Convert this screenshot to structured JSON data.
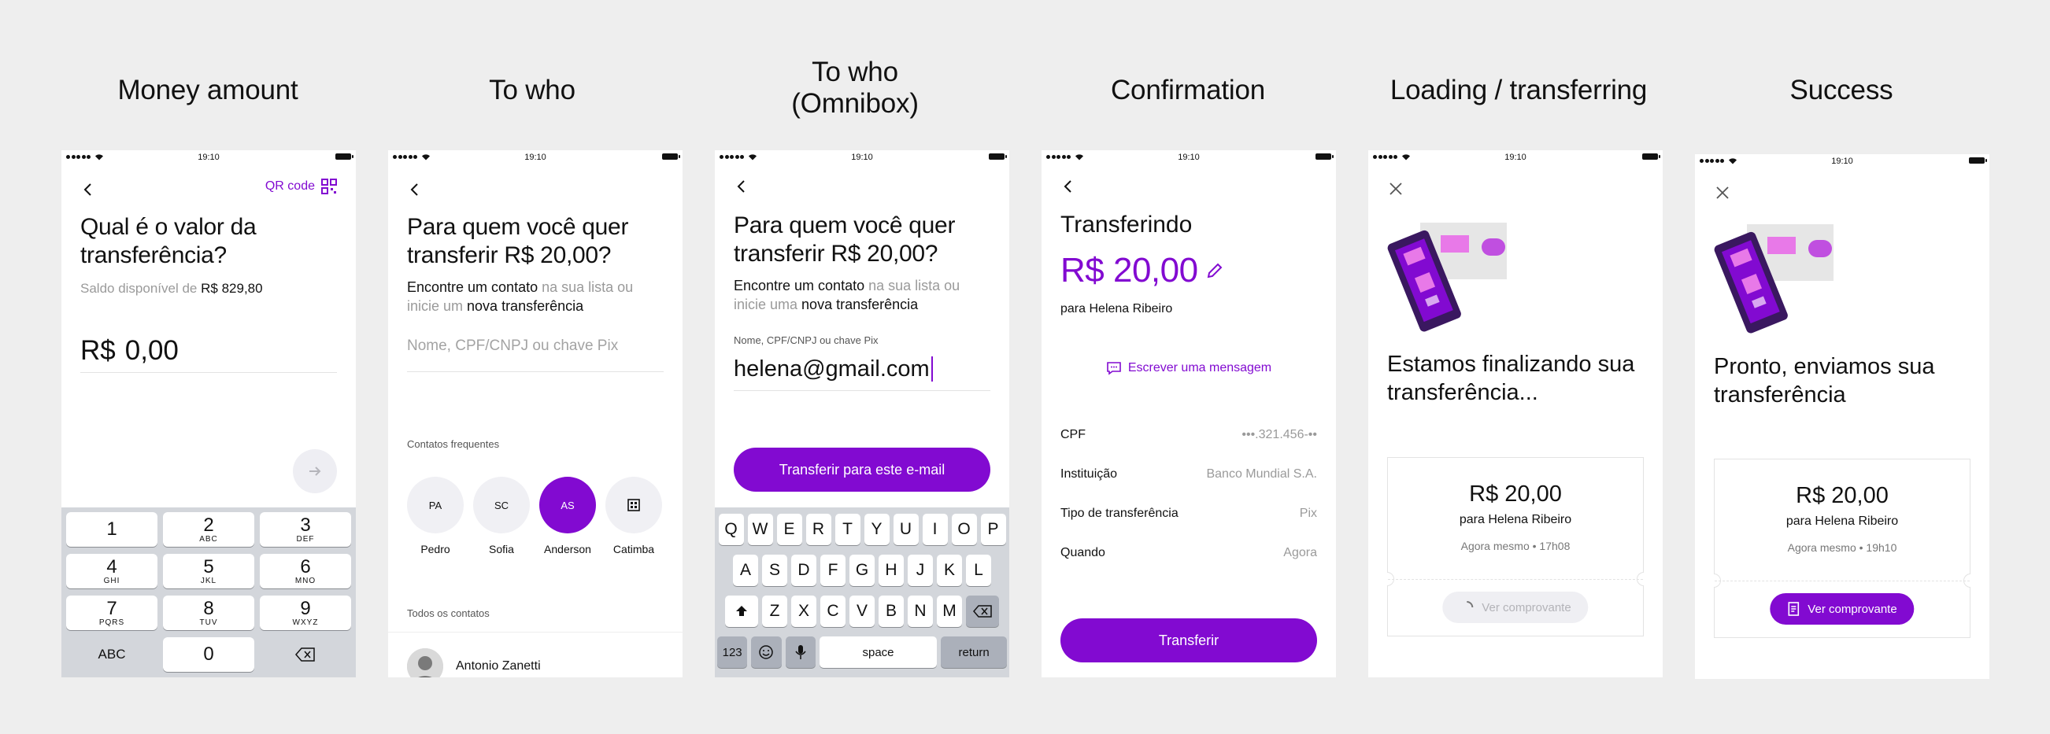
{
  "columns": [
    {
      "title": "Money amount"
    },
    {
      "title": "To who"
    },
    {
      "title": "To who\n(Omnibox)"
    },
    {
      "title": "Confirmation"
    },
    {
      "title": "Loading / transferring"
    },
    {
      "title": "Success"
    }
  ],
  "status_bar": {
    "time": "19:10"
  },
  "screen1": {
    "qr_label": "QR code",
    "title": "Qual é o valor da transferência?",
    "balance_prefix": "Saldo disponível de",
    "balance_value": "R$ 829,80",
    "currency": "R$",
    "amount": "0,00",
    "numpad": [
      {
        "n": "1",
        "l": ""
      },
      {
        "n": "2",
        "l": "ABC"
      },
      {
        "n": "3",
        "l": "DEF"
      },
      {
        "n": "4",
        "l": "GHI"
      },
      {
        "n": "5",
        "l": "JKL"
      },
      {
        "n": "6",
        "l": "MNO"
      },
      {
        "n": "7",
        "l": "PQRS"
      },
      {
        "n": "8",
        "l": "TUV"
      },
      {
        "n": "9",
        "l": "WXYZ"
      }
    ],
    "abc_key": "ABC",
    "zero_key": "0"
  },
  "screen2": {
    "title": "Para quem você quer transferir R$ 20,00?",
    "sub_bold1": "Encontre um contato",
    "sub_text1": " na sua lista ou inicie um ",
    "sub_bold2": "nova transferência",
    "placeholder": "Nome, CPF/CNPJ ou chave Pix",
    "frequent_label": "Contatos frequentes",
    "contacts": [
      {
        "initials": "PA",
        "name": "Pedro"
      },
      {
        "initials": "SC",
        "name": "Sofia"
      },
      {
        "initials": "AS",
        "name": "Anderson"
      },
      {
        "initials": "",
        "name": "Catimba"
      }
    ],
    "all_label": "Todos os contatos",
    "first_contact": "Antonio Zanetti"
  },
  "screen3": {
    "title": "Para quem você quer transferir R$ 20,00?",
    "sub_bold1": "Encontre um contato",
    "sub_text1": " na sua lista ou inicie uma ",
    "sub_bold2": "nova transferência",
    "field_label": "Nome, CPF/CNPJ ou chave Pix",
    "field_value": "helena@gmail.com",
    "button": "Transferir para este e-mail",
    "kb_row1": [
      "Q",
      "W",
      "E",
      "R",
      "T",
      "Y",
      "U",
      "I",
      "O",
      "P"
    ],
    "kb_row2": [
      "A",
      "S",
      "D",
      "F",
      "G",
      "H",
      "J",
      "K",
      "L"
    ],
    "kb_row3": [
      "Z",
      "X",
      "C",
      "V",
      "B",
      "N",
      "M"
    ],
    "kb_num": "123",
    "kb_space": "space",
    "kb_return": "return"
  },
  "screen4": {
    "title": "Transferindo",
    "amount": "R$ 20,00",
    "recipient_prefix": "para",
    "recipient": "Helena Ribeiro",
    "message_link": "Escrever uma mensagem",
    "details": [
      {
        "k": "CPF",
        "v": "•••.321.456-••"
      },
      {
        "k": "Instituição",
        "v": "Banco Mundial S.A."
      },
      {
        "k": "Tipo de transferência",
        "v": "Pix"
      },
      {
        "k": "Quando",
        "v": "Agora"
      }
    ],
    "button": "Transferir"
  },
  "screen5": {
    "title": "Estamos finalizando sua transferência...",
    "amount": "R$ 20,00",
    "recipient": "para Helena Ribeiro",
    "time": "Agora mesmo • 17h08",
    "button": "Ver comprovante"
  },
  "screen6": {
    "title": "Pronto, enviamos sua transferência",
    "amount": "R$ 20,00",
    "recipient": "para Helena Ribeiro",
    "time": "Agora mesmo • 19h10",
    "button": "Ver comprovante"
  },
  "colors": {
    "brand": "#820ad1",
    "illus_pink": "#e879e8",
    "illus_dark": "#3a1860",
    "illus_gray": "#e6e6e6"
  }
}
